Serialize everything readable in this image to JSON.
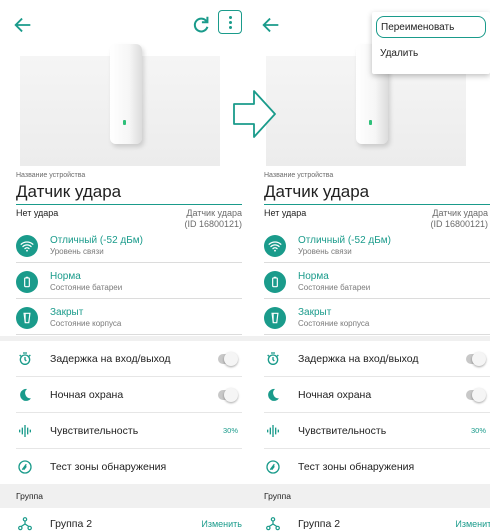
{
  "device": {
    "name_label": "Название устройства",
    "name": "Датчик удара",
    "status": "Нет удара",
    "model_line1": "Датчик удара",
    "model_line2": "(ID 16800121)"
  },
  "info": [
    {
      "title": "Отличный (-52 дБм)",
      "subtitle": "Уровень связи",
      "icon": "wifi-icon"
    },
    {
      "title": "Норма",
      "subtitle": "Состояние батареи",
      "icon": "battery-icon"
    },
    {
      "title": "Закрыт",
      "subtitle": "Состояние корпуса",
      "icon": "case-icon"
    }
  ],
  "settings": [
    {
      "label": "Задержка на вход/выход",
      "icon": "timer-icon",
      "control": "toggle",
      "on": false
    },
    {
      "label": "Ночная охрана",
      "icon": "moon-icon",
      "control": "toggle",
      "on": false
    },
    {
      "label": "Чувствительность",
      "icon": "sensitivity-icon",
      "control": "value",
      "value": "30%"
    },
    {
      "label": "Тест зоны обнаружения",
      "icon": "detection-test-icon",
      "control": "none"
    }
  ],
  "group": {
    "header": "Группа",
    "name": "Группа 2",
    "change_label": "Изменить"
  },
  "menu": {
    "rename": "Переименовать",
    "delete": "Удалить"
  },
  "colors": {
    "accent": "#1a9b8b"
  }
}
